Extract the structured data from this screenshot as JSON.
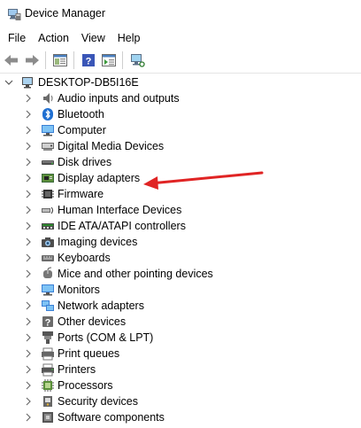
{
  "window": {
    "title": "Device Manager"
  },
  "menu": {
    "file": "File",
    "action": "Action",
    "view": "View",
    "help": "Help"
  },
  "tree": {
    "root": "DESKTOP-DB5I16E",
    "items": [
      {
        "label": "Audio inputs and outputs",
        "icon": "speaker-icon"
      },
      {
        "label": "Bluetooth",
        "icon": "bluetooth-icon"
      },
      {
        "label": "Computer",
        "icon": "computer-icon"
      },
      {
        "label": "Digital Media Devices",
        "icon": "media-device-icon"
      },
      {
        "label": "Disk drives",
        "icon": "disk-drive-icon"
      },
      {
        "label": "Display adapters",
        "icon": "display-adapter-icon"
      },
      {
        "label": "Firmware",
        "icon": "firmware-icon"
      },
      {
        "label": "Human Interface Devices",
        "icon": "hid-icon"
      },
      {
        "label": "IDE ATA/ATAPI controllers",
        "icon": "ide-controller-icon"
      },
      {
        "label": "Imaging devices",
        "icon": "camera-icon"
      },
      {
        "label": "Keyboards",
        "icon": "keyboard-icon"
      },
      {
        "label": "Mice and other pointing devices",
        "icon": "mouse-icon"
      },
      {
        "label": "Monitors",
        "icon": "monitor-icon"
      },
      {
        "label": "Network adapters",
        "icon": "network-adapter-icon"
      },
      {
        "label": "Other devices",
        "icon": "other-devices-icon"
      },
      {
        "label": "Ports (COM & LPT)",
        "icon": "port-icon"
      },
      {
        "label": "Print queues",
        "icon": "print-queue-icon"
      },
      {
        "label": "Printers",
        "icon": "printer-icon"
      },
      {
        "label": "Processors",
        "icon": "processor-icon"
      },
      {
        "label": "Security devices",
        "icon": "security-device-icon"
      },
      {
        "label": "Software components",
        "icon": "software-component-icon"
      }
    ]
  },
  "annotation": {
    "arrow_color": "#e02424"
  }
}
